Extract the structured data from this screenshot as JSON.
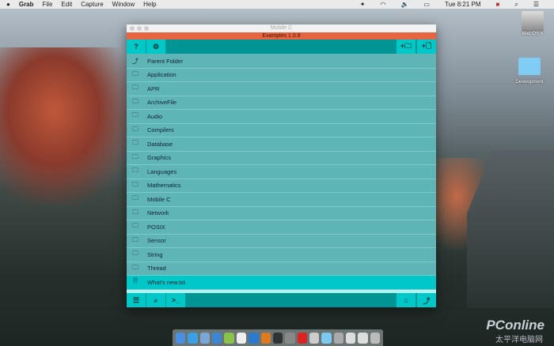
{
  "menubar": {
    "app": "Grab",
    "items": [
      "File",
      "Edit",
      "Capture",
      "Window",
      "Help"
    ],
    "clock": "Tue 8:21 PM"
  },
  "window": {
    "title": "Mobile C",
    "subtitle": "Examples 1.0.8"
  },
  "toolbar": {
    "help": "?",
    "settings": "⚙",
    "new_folder": "+🗀",
    "new_file": "+🗋"
  },
  "list": [
    {
      "icon": "parent-folder-icon",
      "glyph": "⤴",
      "label": "Parent Folder"
    },
    {
      "icon": "folder-icon",
      "glyph": "🗀",
      "label": "Application"
    },
    {
      "icon": "folder-icon",
      "glyph": "🗀",
      "label": "APR"
    },
    {
      "icon": "folder-icon",
      "glyph": "🗀",
      "label": "ArchiveFile"
    },
    {
      "icon": "folder-icon",
      "glyph": "🗀",
      "label": "Audio"
    },
    {
      "icon": "folder-icon",
      "glyph": "🗀",
      "label": "Compilers"
    },
    {
      "icon": "folder-icon",
      "glyph": "🗀",
      "label": "Database"
    },
    {
      "icon": "folder-icon",
      "glyph": "🗀",
      "label": "Graphics"
    },
    {
      "icon": "folder-icon",
      "glyph": "🗀",
      "label": "Languages"
    },
    {
      "icon": "folder-icon",
      "glyph": "🗀",
      "label": "Mathematics"
    },
    {
      "icon": "folder-icon",
      "glyph": "🗀",
      "label": "Mobile C"
    },
    {
      "icon": "folder-icon",
      "glyph": "🗀",
      "label": "Network"
    },
    {
      "icon": "folder-icon",
      "glyph": "🗀",
      "label": "POSIX"
    },
    {
      "icon": "folder-icon",
      "glyph": "🗀",
      "label": "Sensor"
    },
    {
      "icon": "folder-icon",
      "glyph": "🗀",
      "label": "String"
    },
    {
      "icon": "folder-icon",
      "glyph": "🗀",
      "label": "Thread"
    },
    {
      "icon": "file-icon",
      "glyph": "🗎",
      "label": "What's new.txt",
      "selected": true
    }
  ],
  "bottombar": {
    "list": "☰",
    "search": "⌕",
    "terminal": ">_",
    "home": "⌂",
    "up": "⤴"
  },
  "desktop": {
    "disk": "Mac OS X",
    "folder": "Development"
  },
  "watermark": {
    "brand": "PConline",
    "sub": "太平洋电脑网"
  }
}
